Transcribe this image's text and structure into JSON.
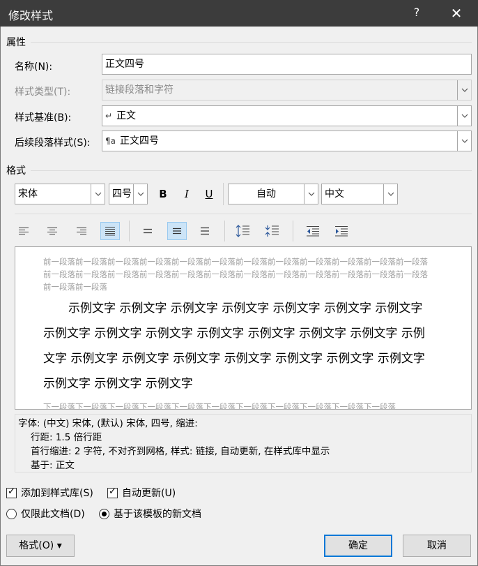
{
  "titlebar": {
    "title": "修改样式",
    "help": "?",
    "close": "✕"
  },
  "properties": {
    "section": "属性",
    "name_label": "名称(N):",
    "name_value": "正文四号",
    "type_label": "样式类型(T):",
    "type_value": "链接段落和字符",
    "based_label": "样式基准(B):",
    "based_glyph": "↵",
    "based_value": "正文",
    "next_label": "后续段落样式(S):",
    "next_glyph": "¶a",
    "next_value": "正文四号"
  },
  "format": {
    "section": "格式",
    "font": "宋体",
    "size": "四号",
    "bold": "B",
    "italic": "I",
    "underline": "U",
    "color": "自动",
    "script": "中文"
  },
  "preview": {
    "prev_text": "前一段落前一段落前一段落前一段落前一段落前一段落前一段落前一段落前一段落前一段落前一段落前一段落前一段落前一段落前一段落前一段落前一段落前一段落前一段落前一段落前一段落前一段落前一段落前一段落前一段落前一段落",
    "sample_text": "示例文字 示例文字 示例文字 示例文字 示例文字 示例文字 示例文字 示例文字 示例文字 示例文字 示例文字 示例文字 示例文字 示例文字 示例文字 示例文字 示例文字 示例文字 示例文字 示例文字 示例文字 示例文字 示例文字 示例文字 示例文字",
    "next_text": "下一段落下一段落下一段落下一段落下一段落下一段落下一段落下一段落下一段落下一段落下一段落"
  },
  "description": {
    "line1": "字体: (中文) 宋体, (默认) 宋体, 四号, 缩进:",
    "line2": "行距: 1.5 倍行距",
    "line3": "首行缩进:  2 字符, 不对齐到网格, 样式: 链接, 自动更新, 在样式库中显示",
    "line4": "基于: 正文"
  },
  "options": {
    "add_gallery": "添加到样式库(S)",
    "auto_update": "自动更新(U)",
    "only_doc": "仅限此文档(D)",
    "new_docs": "基于该模板的新文档"
  },
  "buttons": {
    "format": "格式(O)",
    "format_arrow": "▾",
    "ok": "确定",
    "cancel": "取消"
  },
  "colors": {
    "titlebar": "#3c3c3c",
    "accent": "#0078d7",
    "active_toggle": "#cce4f7"
  }
}
